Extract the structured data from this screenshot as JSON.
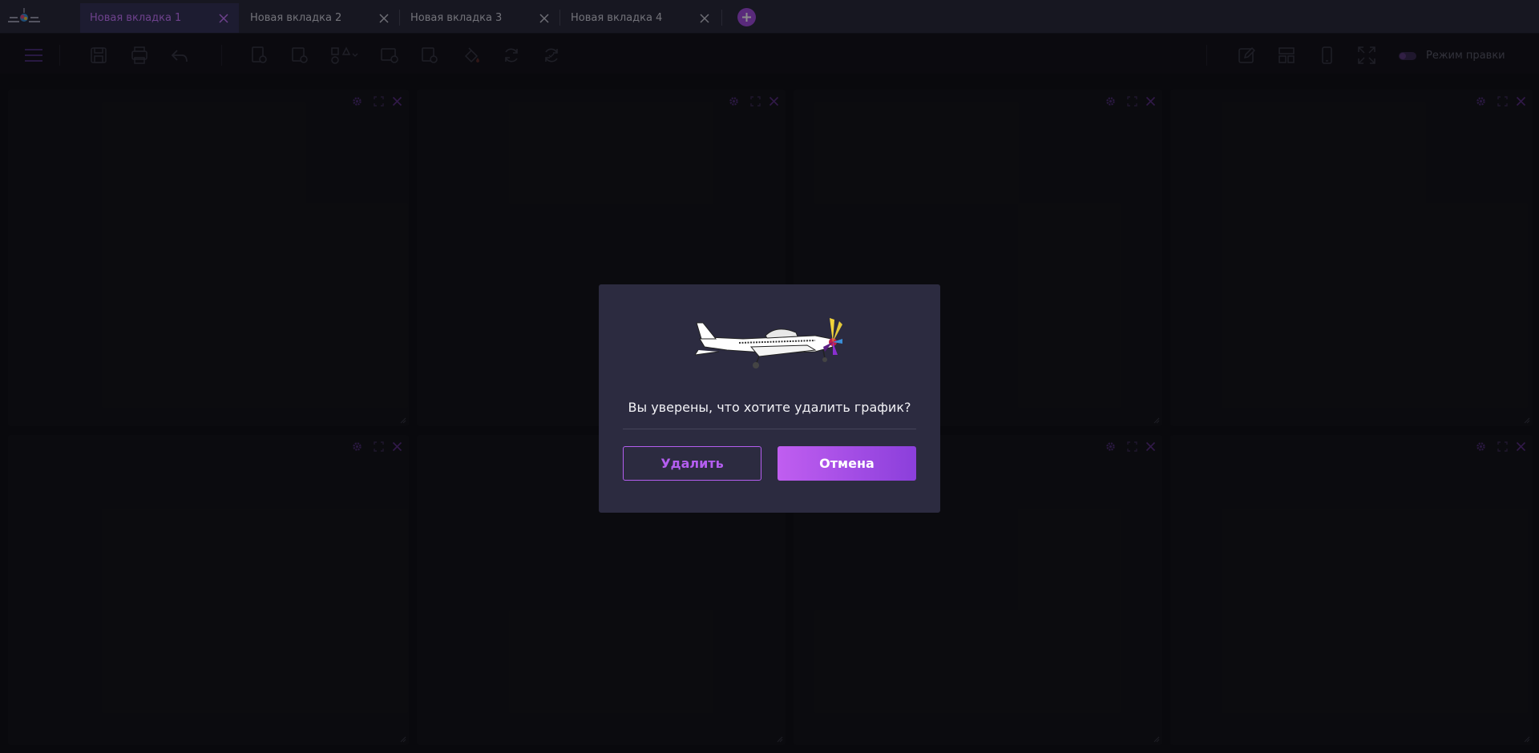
{
  "tabs": [
    {
      "label": "Новая вкладка 1",
      "active": true
    },
    {
      "label": "Новая вкладка 2",
      "active": false
    },
    {
      "label": "Новая вкладка 3",
      "active": false
    },
    {
      "label": "Новая вкладка 4",
      "active": false
    }
  ],
  "toolbar": {
    "icons": [
      "menu-icon",
      "save-icon",
      "pdf-icon",
      "undo-icon",
      "doc-settings-icon",
      "add-chart-icon",
      "shapes-icon",
      "image-settings-icon",
      "add-image-icon",
      "fill-color-icon",
      "refresh-icon",
      "sync-icon",
      "edit-icon",
      "layout-icon",
      "mobile-icon",
      "fullscreen-icon"
    ],
    "edit_mode_label": "Режим правки",
    "edit_mode_on": false
  },
  "panels": {
    "count": 8,
    "controls": [
      "settings-icon",
      "expand-icon",
      "close-icon"
    ]
  },
  "dialog": {
    "message": "Вы уверены, что хотите удалить график?",
    "delete_label": "Удалить",
    "cancel_label": "Отмена"
  },
  "colors": {
    "accent": "#b45ef0",
    "tabbar_bg": "#2a2a3c",
    "dialog_bg": "#2c2b40",
    "panel_bg": "#15151c"
  }
}
